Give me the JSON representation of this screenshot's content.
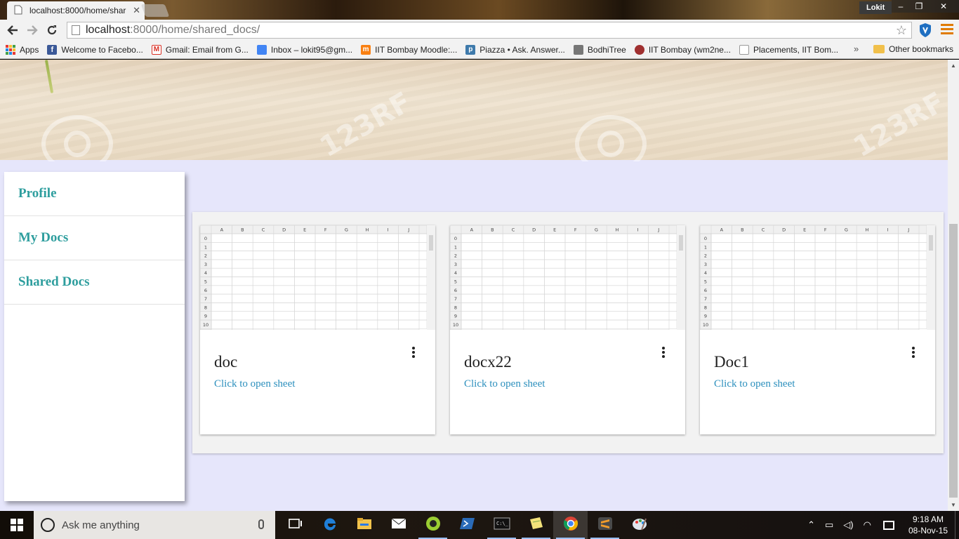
{
  "browser": {
    "tab": {
      "title": "localhost:8000/home/shar"
    },
    "window": {
      "user": "Lokit",
      "minimize": "–",
      "restore": "❐",
      "close": "✕"
    },
    "url": {
      "host": "localhost",
      "path": ":8000/home/shared_docs/"
    },
    "bookmarks": [
      {
        "label": "Apps",
        "icon": "apps-grid-icon"
      },
      {
        "label": "Welcome to Facebo...",
        "icon": "facebook-icon",
        "color": "#3b5998"
      },
      {
        "label": "Gmail: Email from G...",
        "icon": "gmail-icon",
        "color": "#d93025"
      },
      {
        "label": "Inbox – lokit95@gm...",
        "icon": "inbox-icon",
        "color": "#4285f4"
      },
      {
        "label": "IIT Bombay Moodle:...",
        "icon": "moodle-icon",
        "color": "#f98012"
      },
      {
        "label": "Piazza • Ask. Answer...",
        "icon": "piazza-icon",
        "color": "#3e7aab"
      },
      {
        "label": "BodhiTree",
        "icon": "bodhitree-icon",
        "color": "#777777"
      },
      {
        "label": "IIT Bombay (wm2ne...",
        "icon": "iitb-icon",
        "color": "#a03030"
      },
      {
        "label": "Placements, IIT Bom...",
        "icon": "page-icon",
        "color": "#dddddd"
      }
    ],
    "bookmarks_more": "»",
    "other_bookmarks": "Other bookmarks"
  },
  "sidebar": {
    "items": [
      {
        "label": "Profile"
      },
      {
        "label": "My Docs"
      },
      {
        "label": "Shared Docs"
      }
    ]
  },
  "docs": [
    {
      "title": "doc",
      "link": "Click to open sheet"
    },
    {
      "title": "docx22",
      "link": "Click to open sheet"
    },
    {
      "title": "Doc1",
      "link": "Click to open sheet"
    }
  ],
  "sheet_preview": {
    "columns": [
      "A",
      "B",
      "C",
      "D",
      "E",
      "F",
      "G",
      "H",
      "I",
      "J"
    ],
    "rows": [
      "0",
      "1",
      "2",
      "3",
      "4",
      "5",
      "6",
      "7",
      "8",
      "9",
      "10"
    ]
  },
  "banner": {
    "watermark": "123RF"
  },
  "taskbar": {
    "search_placeholder": "Ask me anything",
    "apps": [
      {
        "name": "task-view-icon",
        "running": false
      },
      {
        "name": "edge-icon",
        "running": false
      },
      {
        "name": "file-explorer-icon",
        "running": false
      },
      {
        "name": "mail-icon",
        "running": false
      },
      {
        "name": "cortana-app-icon",
        "running": true
      },
      {
        "name": "powershell-icon",
        "running": false
      },
      {
        "name": "cmd-icon",
        "running": true
      },
      {
        "name": "notes-icon",
        "running": true
      },
      {
        "name": "chrome-icon",
        "running": true,
        "active": true
      },
      {
        "name": "sublime-icon",
        "running": true
      },
      {
        "name": "paint-icon",
        "running": false
      }
    ],
    "time": "9:18 AM",
    "date": "08-Nov-15"
  }
}
